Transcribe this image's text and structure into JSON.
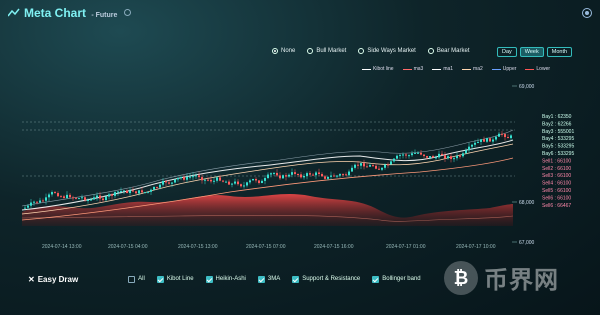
{
  "header": {
    "title": "Meta Chart",
    "subtitle": "- Future"
  },
  "market_modes": [
    {
      "label": "None",
      "selected": true
    },
    {
      "label": "Bull Market",
      "selected": false
    },
    {
      "label": "Side Ways Market",
      "selected": false
    },
    {
      "label": "Bear Market",
      "selected": false
    }
  ],
  "timeframes": [
    {
      "label": "Day",
      "selected": false
    },
    {
      "label": "Week",
      "selected": true
    },
    {
      "label": "Month",
      "selected": false
    }
  ],
  "legend": [
    {
      "label": "Kibot line",
      "color": "#ffffff"
    },
    {
      "label": "ma3",
      "color": "#ff6b6b"
    },
    {
      "label": "ma1",
      "color": "#ffffff"
    },
    {
      "label": "ma2",
      "color": "#ffd6b0"
    },
    {
      "label": "Upper",
      "color": "#6aa0ff"
    },
    {
      "label": "Lower",
      "color": "#ff5555"
    }
  ],
  "price_axis": [
    "69,000",
    "68,000",
    "67,000"
  ],
  "time_axis": [
    "2024-07-14 13:00",
    "2024-07-15 04:00",
    "2024-07-15 13:00",
    "2024-07-15 07:00",
    "2024-07-15 16:00",
    "2024-07-17 01:00",
    "2024-07-17 10:00"
  ],
  "levels": [
    {
      "label": "Bay1 : 62350",
      "type": "bay"
    },
    {
      "label": "Bay2 : 62266",
      "type": "bay"
    },
    {
      "label": "Bay3 : 555001",
      "type": "bay"
    },
    {
      "label": "Bay4 : 533295",
      "type": "bay"
    },
    {
      "label": "Bay5 : 533295",
      "type": "bay"
    },
    {
      "label": "Bay6 : 533295",
      "type": "bay"
    },
    {
      "label": "Sell1 : 66100",
      "type": "sell"
    },
    {
      "label": "Sell2 : 66100",
      "type": "sell"
    },
    {
      "label": "Sell3 : 66100",
      "type": "sell"
    },
    {
      "label": "Sell4 : 66100",
      "type": "sell"
    },
    {
      "label": "Sell5 : 66100",
      "type": "sell"
    },
    {
      "label": "Sell6 : 66100",
      "type": "sell"
    },
    {
      "label": "Sell6 : 66467",
      "type": "sell"
    }
  ],
  "easy_draw": "Easy Draw",
  "toggles": [
    {
      "label": "All",
      "checked": false
    },
    {
      "label": "Kibot Line",
      "checked": true
    },
    {
      "label": "Heikin-Ashi",
      "checked": true
    },
    {
      "label": "3MA",
      "checked": true
    },
    {
      "label": "Support & Resistance",
      "checked": true
    },
    {
      "label": "Bollinger band",
      "checked": true
    }
  ],
  "watermark": "币界网"
}
